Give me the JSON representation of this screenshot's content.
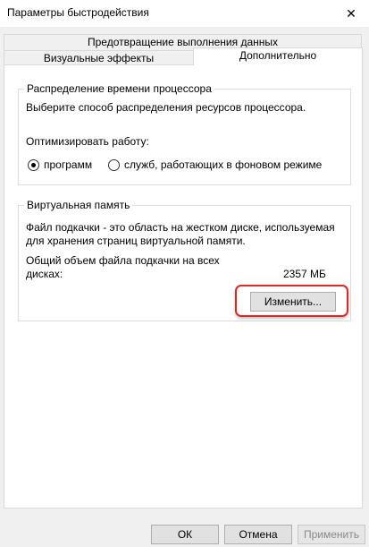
{
  "window": {
    "title": "Параметры быстродействия",
    "close_icon": "close-icon"
  },
  "tabs": {
    "dep": "Предотвращение выполнения данных",
    "visual": "Визуальные эффекты",
    "advanced": "Дополнительно"
  },
  "cpu": {
    "group_title": "Распределение времени процессора",
    "desc": "Выберите способ распределения ресурсов процессора.",
    "optimize_label": "Оптимизировать работу:",
    "option_programs": "программ",
    "option_services": "служб, работающих в фоновом режиме",
    "selected": "программ"
  },
  "virtual_memory": {
    "group_title": "Виртуальная память",
    "desc_line1": "Файл подкачки - это область на жестком диске, используемая",
    "desc_line2": "для хранения страниц виртуальной памяти.",
    "total_label_line1": "Общий объем файла подкачки на всех",
    "total_label_line2": "дисках:",
    "total_value": "2357 МБ",
    "change_button": "Изменить...",
    "highlight_color": "#d92a2a"
  },
  "footer": {
    "ok": "ОК",
    "cancel": "Отмена",
    "apply": "Применить"
  }
}
